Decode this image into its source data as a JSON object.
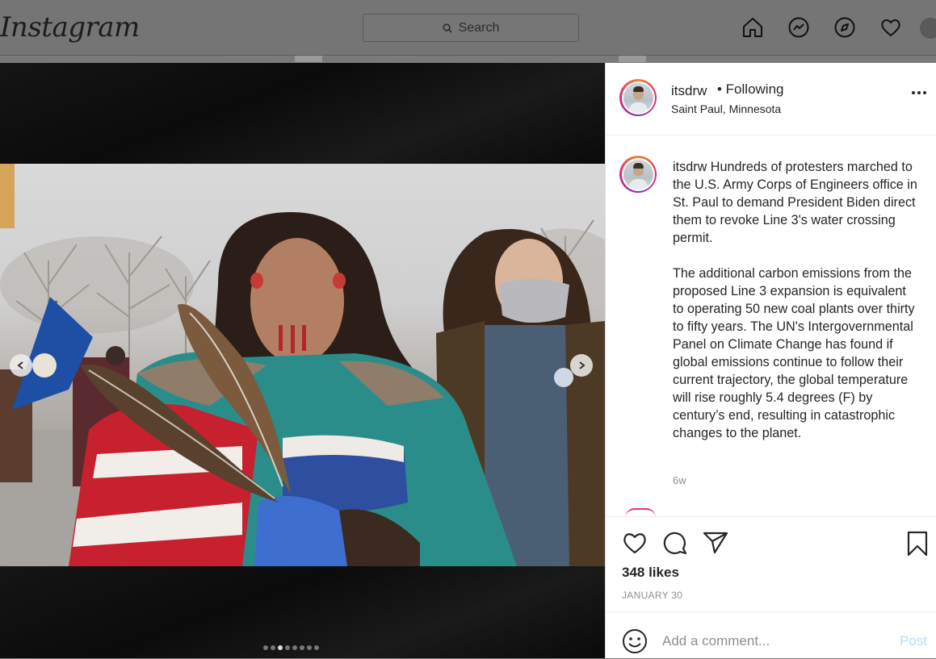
{
  "topbar": {
    "logo": "Instagram",
    "search_placeholder": "Search",
    "icons": [
      "home-icon",
      "messenger-icon",
      "explore-icon",
      "heart-icon",
      "profile-avatar"
    ]
  },
  "post": {
    "username": "itsdrw",
    "following": "• Following",
    "location": "Saint Paul, Minnesota",
    "caption_user": "itsdrw",
    "caption_p1": "Hundreds of protesters marched to the U.S. Army Corps of Engineers office in St. Paul to demand President Biden direct them to revoke Line 3's water crossing permit.",
    "caption_p2": "The additional carbon emissions from the proposed Line 3 expansion is equivalent to operating 50 new coal plants over thirty to fifty years. The UN's Intergovernmental Panel on Climate Change has found if global emissions continue to follow their current trajectory, the global temperature will rise roughly 5.4 degrees (F) by century’s end, resulting in catastrophic changes to the planet.",
    "age": "6w",
    "likes": "348 likes",
    "date": "JANUARY 30",
    "comment_placeholder": "Add a comment...",
    "post_button": "Post",
    "carousel": {
      "count": 8,
      "active_index": 2
    }
  },
  "colors": {
    "accent": "#0095f6",
    "post_disabled": "#b2dffc",
    "overlay": "#757575"
  }
}
